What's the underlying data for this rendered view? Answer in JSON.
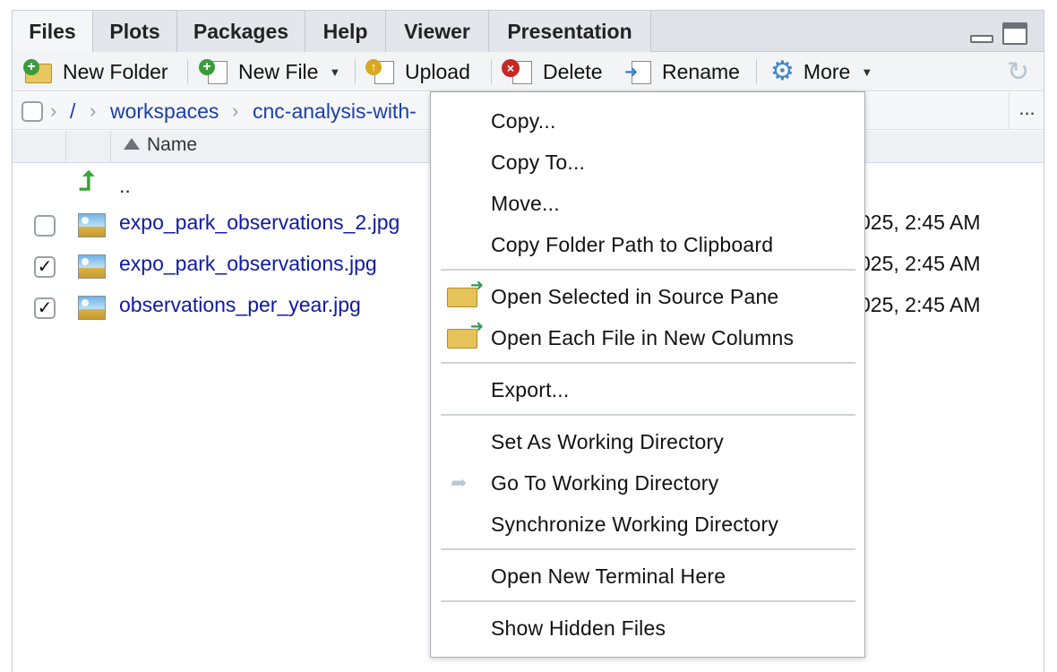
{
  "tabs": [
    {
      "label": "Files",
      "active": true
    },
    {
      "label": "Plots"
    },
    {
      "label": "Packages"
    },
    {
      "label": "Help"
    },
    {
      "label": "Viewer"
    },
    {
      "label": "Presentation"
    }
  ],
  "toolbar": {
    "new_folder": "New Folder",
    "new_file": "New File",
    "upload": "Upload",
    "delete": "Delete",
    "rename": "Rename",
    "more": "More"
  },
  "breadcrumb": {
    "root": "/",
    "items": [
      "workspaces",
      "cnc-analysis-with-"
    ],
    "overflow": "..."
  },
  "table": {
    "name_header": "Name",
    "parent": "..",
    "rows": [
      {
        "name": "expo_park_observations_2.jpg",
        "checked": false,
        "modified": "025, 2:45 AM"
      },
      {
        "name": "expo_park_observations.jpg",
        "checked": true,
        "modified": "025, 2:45 AM"
      },
      {
        "name": "observations_per_year.jpg",
        "checked": true,
        "modified": "025, 2:45 AM"
      }
    ]
  },
  "menu": {
    "copy": "Copy...",
    "copy_to": "Copy To...",
    "move": "Move...",
    "copy_folder_path": "Copy Folder Path to Clipboard",
    "open_selected": "Open Selected in Source Pane",
    "open_each": "Open Each File in New Columns",
    "export": "Export...",
    "set_wd": "Set As Working Directory",
    "go_wd": "Go To Working Directory",
    "sync_wd": "Synchronize Working Directory",
    "new_terminal": "Open New Terminal Here",
    "show_hidden": "Show Hidden Files"
  },
  "icons": {
    "checkmark": "✓"
  },
  "colors": {
    "link": "#0f1aa0",
    "breadcrumb_link": "#1a3fa8",
    "accent_gear": "#3f86c9"
  }
}
